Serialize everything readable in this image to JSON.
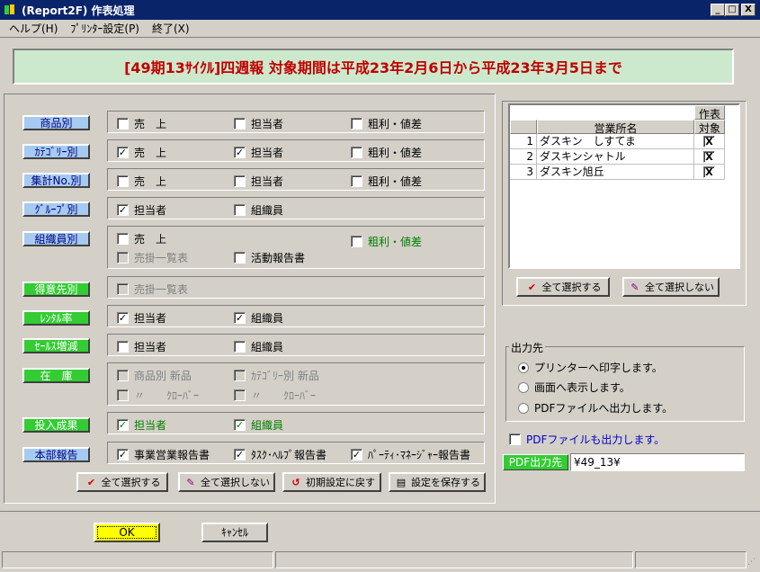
{
  "window": {
    "title": "(Report2F) 作表処理",
    "min": "_",
    "max": "□",
    "close": "X"
  },
  "menu": [
    "ヘルプ(H)",
    "ﾌﾟﾘﾝﾀｰ設定(P)",
    "終了(X)"
  ],
  "banner": "[49期13ｻｲｸﾙ]四週報 対象期間は平成23年2月6日から平成23年3月5日まで",
  "categories": [
    {
      "label": "商品別",
      "style": "blue"
    },
    {
      "label": "ｶﾃｺﾞﾘｰ別",
      "style": "blue"
    },
    {
      "label": "集計No.別",
      "style": "blue"
    },
    {
      "label": "ｸﾞﾙｰﾌﾟ別",
      "style": "blue"
    },
    {
      "label": "組織員別",
      "style": "blue"
    },
    {
      "label": "得意先別",
      "style": "green"
    },
    {
      "label": "ﾚﾝﾀﾙ率",
      "style": "green"
    },
    {
      "label": "ｾｰﾙｽ増減",
      "style": "green"
    },
    {
      "label": "在　庫",
      "style": "green"
    },
    {
      "label": "投入成果",
      "style": "green"
    },
    {
      "label": "本部報告",
      "style": "blue"
    }
  ],
  "options": {
    "r1": [
      {
        "label": "売　上",
        "checked": false
      },
      {
        "label": "担当者",
        "checked": false
      },
      {
        "label": "粗利・値差",
        "checked": false
      }
    ],
    "r2": [
      {
        "label": "売　上",
        "checked": true
      },
      {
        "label": "担当者",
        "checked": true
      },
      {
        "label": "粗利・値差",
        "checked": false
      }
    ],
    "r3": [
      {
        "label": "売　上",
        "checked": false
      },
      {
        "label": "担当者",
        "checked": false
      },
      {
        "label": "粗利・値差",
        "checked": false
      }
    ],
    "r4": [
      {
        "label": "担当者",
        "checked": true
      },
      {
        "label": "組織員",
        "checked": false
      }
    ],
    "r5": [
      {
        "label": "売　上",
        "checked": false
      },
      {
        "label": "粗利・値差",
        "checked": false
      },
      {
        "label": "売掛一覧表",
        "checked": false
      },
      {
        "label": "活動報告書",
        "checked": false
      }
    ],
    "r6": [
      {
        "label": "売掛一覧表",
        "checked": false
      }
    ],
    "r7": [
      {
        "label": "担当者",
        "checked": true
      },
      {
        "label": "組織員",
        "checked": true
      }
    ],
    "r8": [
      {
        "label": "担当者",
        "checked": false
      },
      {
        "label": "組織員",
        "checked": false
      }
    ],
    "r9": [
      {
        "label": "商品別 新品",
        "checked": false
      },
      {
        "label": "ｶﾃｺﾞﾘｰ別 新品",
        "checked": false
      },
      {
        "label": "〃　　ｸﾛｰﾊﾞｰ",
        "checked": false
      },
      {
        "label": "〃　　ｸﾛｰﾊﾞｰ",
        "checked": false
      }
    ],
    "r10": [
      {
        "label": "担当者",
        "checked": true
      },
      {
        "label": "組織員",
        "checked": true
      }
    ],
    "r11": [
      {
        "label": "事業営業報告書",
        "checked": true
      },
      {
        "label": "ﾀｽｸ･ﾍﾙﾌﾟ報告書",
        "checked": true
      },
      {
        "label": "ﾊﾟｰﾃｨ･ﾏﾈｰｼﾞｬｰ報告書",
        "checked": true
      }
    ]
  },
  "left_buttons": {
    "select_all": "全て選択する",
    "deselect_all": "全て選択しない",
    "reset": "初期設定に戻す",
    "save": "設定を保存する"
  },
  "grid": {
    "header_top": "作表",
    "col_name": "営業所名",
    "col_target": "対象",
    "rows": [
      {
        "no": "1",
        "name": "ダスキン　しすてま",
        "mark": "X"
      },
      {
        "no": "2",
        "name": "ダスキンシャトル",
        "mark": "X"
      },
      {
        "no": "3",
        "name": "ダスキン旭丘",
        "mark": "X"
      }
    ]
  },
  "right_buttons": {
    "select_all": "全て選択する",
    "deselect_all": "全て選択しない"
  },
  "output": {
    "legend": "出力先",
    "options": [
      {
        "label": "プリンターへ印字します。",
        "selected": true
      },
      {
        "label": "画面へ表示します。",
        "selected": false
      },
      {
        "label": "PDFファイルへ出力します。",
        "selected": false
      }
    ]
  },
  "pdf_also": {
    "label": "PDFファイルも出力します。",
    "checked": false
  },
  "pdf_dest": {
    "label": "PDF出力先",
    "value": "¥49_13¥"
  },
  "bottom": {
    "ok": "OK",
    "cancel": "ｷｬﾝｾﾙ"
  }
}
